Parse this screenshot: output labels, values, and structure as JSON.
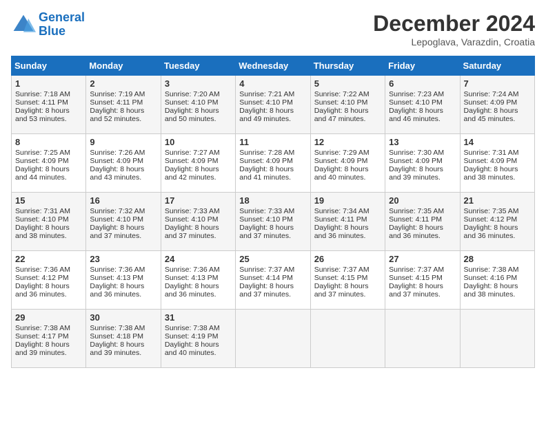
{
  "header": {
    "logo_general": "General",
    "logo_blue": "Blue",
    "month_title": "December 2024",
    "location": "Lepoglava, Varazdin, Croatia"
  },
  "days_of_week": [
    "Sunday",
    "Monday",
    "Tuesday",
    "Wednesday",
    "Thursday",
    "Friday",
    "Saturday"
  ],
  "weeks": [
    [
      {
        "day": "1",
        "sunrise": "7:18 AM",
        "sunset": "4:11 PM",
        "daylight": "8 hours and 53 minutes."
      },
      {
        "day": "2",
        "sunrise": "7:19 AM",
        "sunset": "4:11 PM",
        "daylight": "8 hours and 52 minutes."
      },
      {
        "day": "3",
        "sunrise": "7:20 AM",
        "sunset": "4:10 PM",
        "daylight": "8 hours and 50 minutes."
      },
      {
        "day": "4",
        "sunrise": "7:21 AM",
        "sunset": "4:10 PM",
        "daylight": "8 hours and 49 minutes."
      },
      {
        "day": "5",
        "sunrise": "7:22 AM",
        "sunset": "4:10 PM",
        "daylight": "8 hours and 47 minutes."
      },
      {
        "day": "6",
        "sunrise": "7:23 AM",
        "sunset": "4:10 PM",
        "daylight": "8 hours and 46 minutes."
      },
      {
        "day": "7",
        "sunrise": "7:24 AM",
        "sunset": "4:09 PM",
        "daylight": "8 hours and 45 minutes."
      }
    ],
    [
      {
        "day": "8",
        "sunrise": "7:25 AM",
        "sunset": "4:09 PM",
        "daylight": "8 hours and 44 minutes."
      },
      {
        "day": "9",
        "sunrise": "7:26 AM",
        "sunset": "4:09 PM",
        "daylight": "8 hours and 43 minutes."
      },
      {
        "day": "10",
        "sunrise": "7:27 AM",
        "sunset": "4:09 PM",
        "daylight": "8 hours and 42 minutes."
      },
      {
        "day": "11",
        "sunrise": "7:28 AM",
        "sunset": "4:09 PM",
        "daylight": "8 hours and 41 minutes."
      },
      {
        "day": "12",
        "sunrise": "7:29 AM",
        "sunset": "4:09 PM",
        "daylight": "8 hours and 40 minutes."
      },
      {
        "day": "13",
        "sunrise": "7:30 AM",
        "sunset": "4:09 PM",
        "daylight": "8 hours and 39 minutes."
      },
      {
        "day": "14",
        "sunrise": "7:31 AM",
        "sunset": "4:09 PM",
        "daylight": "8 hours and 38 minutes."
      }
    ],
    [
      {
        "day": "15",
        "sunrise": "7:31 AM",
        "sunset": "4:10 PM",
        "daylight": "8 hours and 38 minutes."
      },
      {
        "day": "16",
        "sunrise": "7:32 AM",
        "sunset": "4:10 PM",
        "daylight": "8 hours and 37 minutes."
      },
      {
        "day": "17",
        "sunrise": "7:33 AM",
        "sunset": "4:10 PM",
        "daylight": "8 hours and 37 minutes."
      },
      {
        "day": "18",
        "sunrise": "7:33 AM",
        "sunset": "4:10 PM",
        "daylight": "8 hours and 37 minutes."
      },
      {
        "day": "19",
        "sunrise": "7:34 AM",
        "sunset": "4:11 PM",
        "daylight": "8 hours and 36 minutes."
      },
      {
        "day": "20",
        "sunrise": "7:35 AM",
        "sunset": "4:11 PM",
        "daylight": "8 hours and 36 minutes."
      },
      {
        "day": "21",
        "sunrise": "7:35 AM",
        "sunset": "4:12 PM",
        "daylight": "8 hours and 36 minutes."
      }
    ],
    [
      {
        "day": "22",
        "sunrise": "7:36 AM",
        "sunset": "4:12 PM",
        "daylight": "8 hours and 36 minutes."
      },
      {
        "day": "23",
        "sunrise": "7:36 AM",
        "sunset": "4:13 PM",
        "daylight": "8 hours and 36 minutes."
      },
      {
        "day": "24",
        "sunrise": "7:36 AM",
        "sunset": "4:13 PM",
        "daylight": "8 hours and 36 minutes."
      },
      {
        "day": "25",
        "sunrise": "7:37 AM",
        "sunset": "4:14 PM",
        "daylight": "8 hours and 37 minutes."
      },
      {
        "day": "26",
        "sunrise": "7:37 AM",
        "sunset": "4:15 PM",
        "daylight": "8 hours and 37 minutes."
      },
      {
        "day": "27",
        "sunrise": "7:37 AM",
        "sunset": "4:15 PM",
        "daylight": "8 hours and 37 minutes."
      },
      {
        "day": "28",
        "sunrise": "7:38 AM",
        "sunset": "4:16 PM",
        "daylight": "8 hours and 38 minutes."
      }
    ],
    [
      {
        "day": "29",
        "sunrise": "7:38 AM",
        "sunset": "4:17 PM",
        "daylight": "8 hours and 39 minutes."
      },
      {
        "day": "30",
        "sunrise": "7:38 AM",
        "sunset": "4:18 PM",
        "daylight": "8 hours and 39 minutes."
      },
      {
        "day": "31",
        "sunrise": "7:38 AM",
        "sunset": "4:19 PM",
        "daylight": "8 hours and 40 minutes."
      },
      null,
      null,
      null,
      null
    ]
  ],
  "labels": {
    "sunrise": "Sunrise:",
    "sunset": "Sunset:",
    "daylight": "Daylight:"
  }
}
